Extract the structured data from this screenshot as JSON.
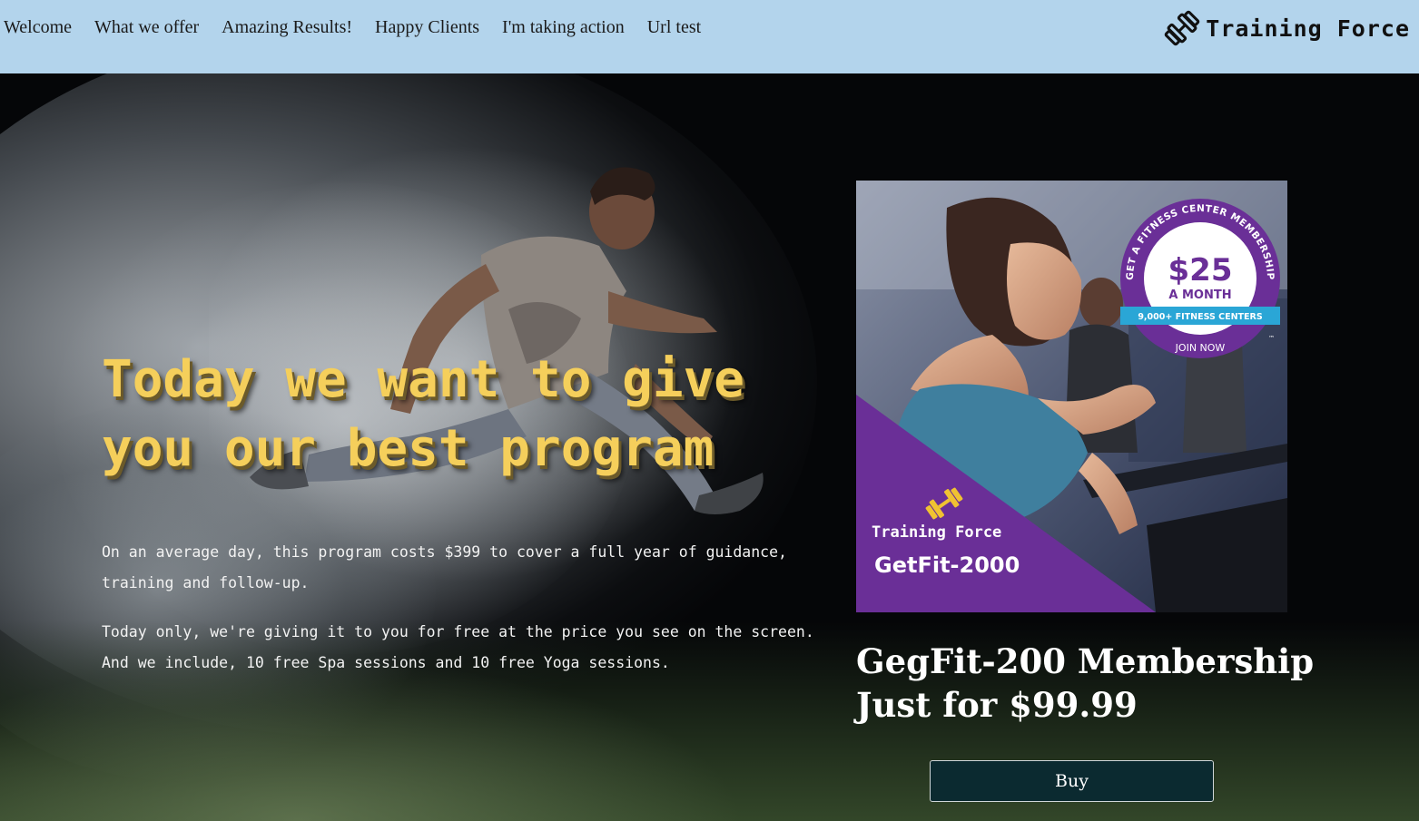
{
  "nav": {
    "links": [
      "Welcome",
      "What we offer",
      "Amazing Results!",
      "Happy Clients",
      "I'm taking action",
      "Url test"
    ]
  },
  "brand": {
    "name": "Training Force",
    "icon": "dumbbell-icon"
  },
  "hero": {
    "headline": "Today we want to give you our best program",
    "paragraph_1": "On an average day, this program costs $399 to cover a full year of guidance, training and follow-up.",
    "paragraph_2": "Today only, we're giving it to you for free at the price you see on the screen. And we include, 10 free Spa sessions and 10 free Yoga sessions."
  },
  "ad": {
    "badge_arc_top": "GET A FITNESS CENTER MEMBERSHIP",
    "badge_price": "$25",
    "badge_period": "A MONTH",
    "badge_ribbon": "9,000+ FITNESS CENTERS",
    "badge_arc_bottom": "JOIN NOW",
    "badge_tm": "™",
    "brand": "Training Force",
    "product": "GetFit-2000"
  },
  "offer": {
    "title_line_1": "GegFit-200 Membership",
    "title_line_2": "Just for $99.99",
    "buy_label": "Buy"
  },
  "colors": {
    "nav_bg": "#b3d4ec",
    "headline": "#f5cf5b",
    "button_bg": "#0b2a30",
    "ad_purple": "#6a2f97",
    "ad_teal": "#2aa6d6"
  }
}
